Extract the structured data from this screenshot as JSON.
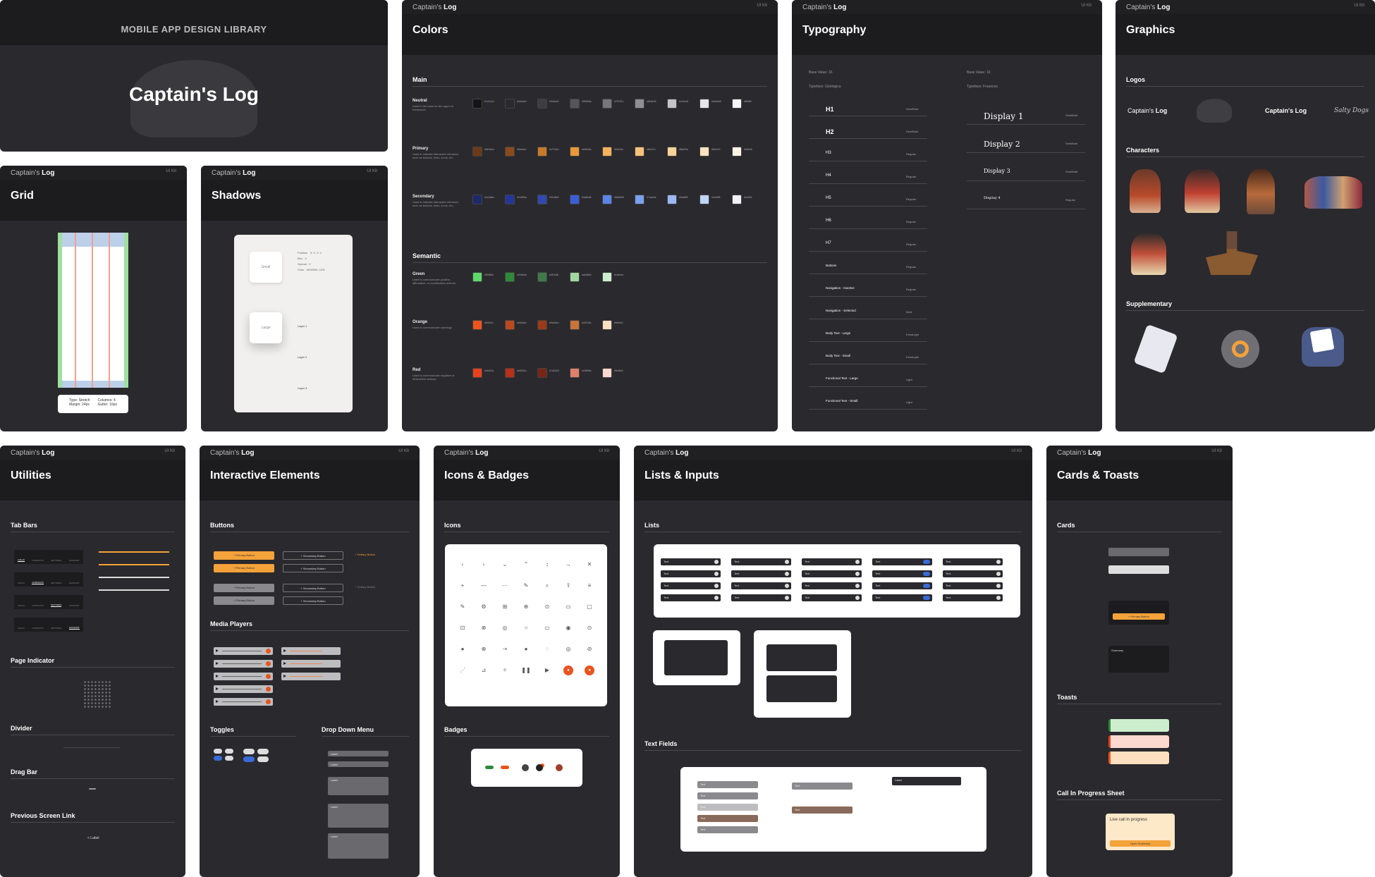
{
  "brand": {
    "app": "Captain's",
    "app_bold": "Log",
    "version": "UI Kit",
    "library_title": "MOBILE APP DESIGN LIBRARY",
    "logo_text": "Captain's Log"
  },
  "pages": {
    "grid": "Grid",
    "shadows": "Shadows",
    "colors": "Colors",
    "typography": "Typography",
    "graphics": "Graphics",
    "utilities": "Utilities",
    "interactive": "Interactive Elements",
    "icons": "Icons & Badges",
    "lists": "Lists & Inputs",
    "cards": "Cards & Toasts"
  },
  "grid": {
    "cols": [
      "16px",
      "16px",
      "16px",
      "16px",
      "16px"
    ],
    "note_left": "Type: Stretch",
    "note_left2": "Margin: 24px",
    "note_right": "Columns: 4",
    "note_right2": "Gutter: 16px"
  },
  "shadows": {
    "small": "Small",
    "large": "Large",
    "small_props": [
      "Position",
      "Blur",
      "Spread",
      "Color"
    ],
    "small_vals": [
      "X: 0, Y: 2",
      "4",
      "0",
      "#000000, 10%"
    ],
    "layers": [
      "Layer 1",
      "Layer 2",
      "Layer 3"
    ]
  },
  "colors": {
    "main": "Main",
    "semantic": "Semantic",
    "main_groups": [
      {
        "name": "Neutral",
        "desc": "Used in the base for the app's UI framework.",
        "swatches": [
          "#141414",
          "#2a2a2e",
          "#3d3d42",
          "#55555a",
          "#76767c",
          "#8e8e94",
          "#c4c4c8",
          "#e6e6e8",
          "#f6f6f6"
        ]
      },
      {
        "name": "Primary",
        "desc": "Used to indicate interactive elements such as buttons, links, icons, etc.",
        "swatches": [
          "#6b3a1a",
          "#8a4a1c",
          "#c77a2a",
          "#e89a3a",
          "#f4b25a",
          "#f6c27a",
          "#f8d29a",
          "#fbe2c0",
          "#fdf2e6"
        ]
      },
      {
        "name": "Secondary",
        "desc": "Used to indicate interactive elements such as buttons, links, icons, etc.",
        "swatches": [
          "#1c2a6a",
          "#24359a",
          "#3148b0",
          "#3a5ed6",
          "#5a84e8",
          "#7aa0ee",
          "#9ab8f2",
          "#c0d4f8",
          "#eef3fc"
        ]
      }
    ],
    "semantic_groups": [
      {
        "name": "Green",
        "desc": "Used to communicate positive, affirmative, or confirmation actions.",
        "swatches": [
          "#5fd86a",
          "#2e8a3a",
          "#3f7a48",
          "#a0d8a0",
          "#cdeecd"
        ]
      },
      {
        "name": "Orange",
        "desc": "Used to communicate warnings.",
        "swatches": [
          "#f0541e",
          "#b84a1e",
          "#9a3a1a",
          "#c8743a",
          "#fde0c0"
        ]
      },
      {
        "name": "Red",
        "desc": "Used to communicate negative or destructive actions.",
        "swatches": [
          "#e8411e",
          "#b8301a",
          "#7a2418",
          "#e0806a",
          "#fbd8d0"
        ]
      }
    ]
  },
  "typography": {
    "base_left": "Base Value: 16",
    "typeface_left": "Typeface: Geologica",
    "base_right": "Base Value: 16",
    "typeface_right": "Typeface: Fraunces",
    "left_rows": [
      {
        "name": "H1",
        "weight": "SemiBold"
      },
      {
        "name": "H2",
        "weight": "SemiBold"
      },
      {
        "name": "H3",
        "weight": "Regular"
      },
      {
        "name": "H4",
        "weight": "Regular"
      },
      {
        "name": "H5",
        "weight": "Regular"
      },
      {
        "name": "H6",
        "weight": "Regular"
      },
      {
        "name": "H7",
        "weight": "Regular"
      },
      {
        "name": "Buttons",
        "weight": "Regular"
      },
      {
        "name": "Navigation - Inactive",
        "weight": "Regular"
      },
      {
        "name": "Navigation - Selected",
        "weight": "Bold"
      },
      {
        "name": "Body Text - Large",
        "weight": "ExtraLight"
      },
      {
        "name": "Body Text - Small",
        "weight": "ExtraLight"
      },
      {
        "name": "Functional Text - Large",
        "weight": "Light"
      },
      {
        "name": "Functional Text - Small",
        "weight": "Light"
      }
    ],
    "right_rows": [
      {
        "name": "Display 1",
        "weight": "SemiBold"
      },
      {
        "name": "Display 2",
        "weight": "SemiBold"
      },
      {
        "name": "Display 3",
        "weight": "SemiBold"
      },
      {
        "name": "Display 4",
        "weight": "Regular"
      }
    ]
  },
  "graphics": {
    "logos": "Logos",
    "characters": "Characters",
    "supplementary": "Supplementary",
    "logo_script": "Salty Dogs"
  },
  "utilities": {
    "tab_bars": "Tab Bars",
    "page_indicator": "Page Indicator",
    "divider": "Divider",
    "drag_bar": "Drag Bar",
    "prev_link": "Previous Screen Link",
    "back_label": "< Label",
    "tabs": [
      "CALLS",
      "CONTACTS",
      "SETTINGS",
      "ACCOUNT"
    ]
  },
  "interactive": {
    "buttons": "Buttons",
    "media_players": "Media Players",
    "toggles": "Toggles",
    "dropdown": "Drop Down Menu",
    "primary": "+ Primary Button",
    "secondary": "+ Secondary Button",
    "tertiary": "+ Tertiary Button",
    "dd_label": "Label"
  },
  "icons": {
    "icons": "Icons",
    "badges": "Badges"
  },
  "lists": {
    "lists": "Lists",
    "text_fields": "Text Fields",
    "item": "Text",
    "label": "Label"
  },
  "cards": {
    "cards": "Cards",
    "toasts": "Toasts",
    "call_sheet": "Call In Progress Sheet",
    "live_call": "Live call in progress",
    "open_summary": "Open Summary",
    "primary_btn": "+ Primary Button",
    "summary": "Summary"
  }
}
